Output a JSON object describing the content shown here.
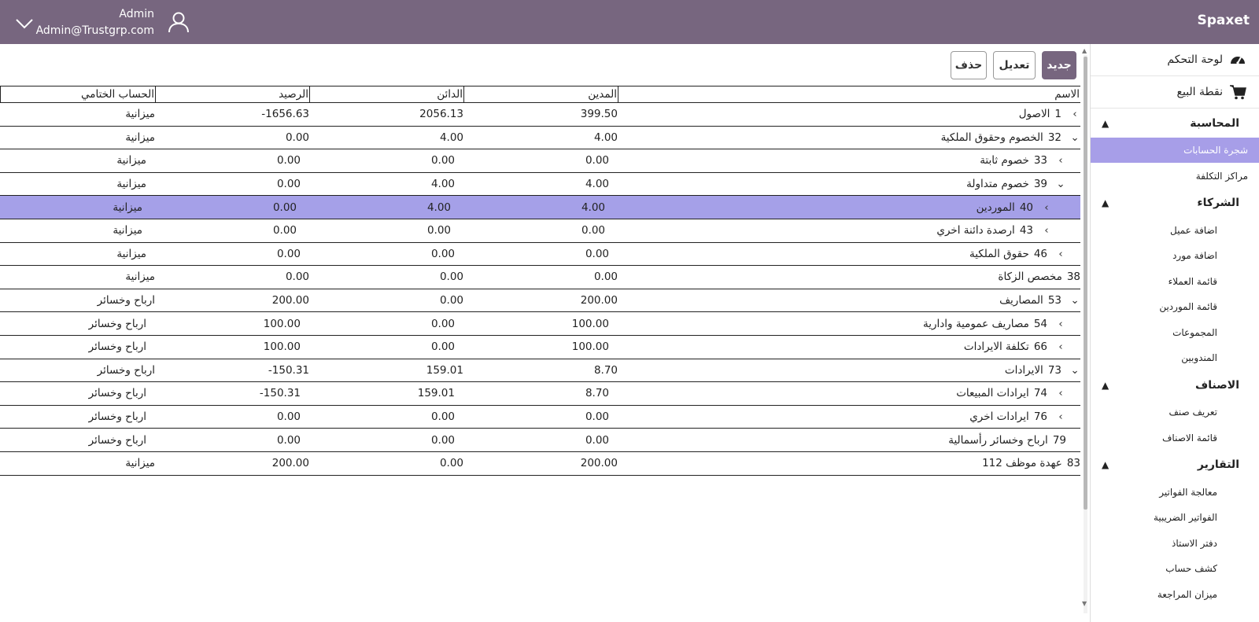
{
  "header": {
    "brand": "Spaxet",
    "user_name": "Admin",
    "user_email": "Admin@Trustgrp.com",
    "bg_color": "#77667f"
  },
  "toolbar": {
    "new_label": "جديد",
    "edit_label": "تعديل",
    "delete_label": "حذف"
  },
  "sidebar": {
    "dashboard": "لوحة التحكم",
    "pos": "نقطة البيع",
    "sections": [
      {
        "title": "المحاسبة",
        "items": [
          "شجرة الحسابات",
          "مراكز التكلفة"
        ]
      },
      {
        "title": "الشركاء",
        "items": [
          "اضافة عميل",
          "اضافة مورد",
          "قائمة العملاء",
          "قائمة الموردين",
          "المجموعات",
          "المندوبين"
        ]
      },
      {
        "title": "الاصناف",
        "items": [
          "تعريف صنف",
          "قائمة الاصناف"
        ]
      },
      {
        "title": "التقارير",
        "items": [
          "معالجة الفواتير",
          "الفواتير الضريبية",
          "دفتر الاستاذ",
          "كشف حساب",
          "ميزان المراجعة"
        ]
      }
    ],
    "active_item": "شجرة الحسابات",
    "active_color": "#a79ee8"
  },
  "table": {
    "columns": [
      "الاسم",
      "المدين",
      "الدائن",
      "الرصيد",
      "الحساب الختامي"
    ],
    "selected_color": "#a5a0e8",
    "rows": [
      {
        "code": "1",
        "name": "الاصول",
        "toggle": "›",
        "level": 0,
        "debit": "399.50",
        "credit": "2056.13",
        "balance": "-1656.63",
        "final": "ميزانية"
      },
      {
        "code": "32",
        "name": "الخصوم وحقوق الملكية",
        "toggle": "⌄",
        "level": 0,
        "debit": "4.00",
        "credit": "4.00",
        "balance": "0.00",
        "final": "ميزانية"
      },
      {
        "code": "33",
        "name": "خصوم ثابتة",
        "toggle": "›",
        "level": 1,
        "debit": "0.00",
        "credit": "0.00",
        "balance": "0.00",
        "final": "ميزانية"
      },
      {
        "code": "39",
        "name": "خصوم متداولة",
        "toggle": "⌄",
        "level": 1,
        "debit": "4.00",
        "credit": "4.00",
        "balance": "0.00",
        "final": "ميزانية"
      },
      {
        "code": "40",
        "name": "الموردين",
        "toggle": "›",
        "level": 2,
        "debit": "4.00",
        "credit": "4.00",
        "balance": "0.00",
        "final": "ميزانية",
        "selected": true
      },
      {
        "code": "43",
        "name": "ارصدة دائنة اخري",
        "toggle": "›",
        "level": 2,
        "debit": "0.00",
        "credit": "0.00",
        "balance": "0.00",
        "final": "ميزانية"
      },
      {
        "code": "46",
        "name": "حقوق الملكية",
        "toggle": "›",
        "level": 1,
        "debit": "0.00",
        "credit": "0.00",
        "balance": "0.00",
        "final": "ميزانية"
      },
      {
        "code": "38",
        "name": "مخصص الزكاة",
        "toggle": "",
        "level": 0,
        "debit": "0.00",
        "credit": "0.00",
        "balance": "0.00",
        "final": "ميزانية"
      },
      {
        "code": "53",
        "name": "المصاريف",
        "toggle": "⌄",
        "level": 0,
        "debit": "200.00",
        "credit": "0.00",
        "balance": "200.00",
        "final": "ارباح وخسائر"
      },
      {
        "code": "54",
        "name": "مصاريف عمومية وادارية",
        "toggle": "›",
        "level": 1,
        "debit": "100.00",
        "credit": "0.00",
        "balance": "100.00",
        "final": "ارباح وخسائر"
      },
      {
        "code": "66",
        "name": "تكلفة الايرادات",
        "toggle": "›",
        "level": 1,
        "debit": "100.00",
        "credit": "0.00",
        "balance": "100.00",
        "final": "ارباح وخسائر"
      },
      {
        "code": "73",
        "name": "الايرادات",
        "toggle": "⌄",
        "level": 0,
        "debit": "8.70",
        "credit": "159.01",
        "balance": "-150.31",
        "final": "ارباح وخسائر"
      },
      {
        "code": "74",
        "name": "ايرادات المبيعات",
        "toggle": "›",
        "level": 1,
        "debit": "8.70",
        "credit": "159.01",
        "balance": "-150.31",
        "final": "ارباح وخسائر"
      },
      {
        "code": "76",
        "name": "ايرادات اخري",
        "toggle": "›",
        "level": 1,
        "debit": "0.00",
        "credit": "0.00",
        "balance": "0.00",
        "final": "ارباح وخسائر"
      },
      {
        "code": "79",
        "name": "ارباح وخسائر رأسمالية",
        "toggle": "",
        "level": 1,
        "debit": "0.00",
        "credit": "0.00",
        "balance": "0.00",
        "final": "ارباح وخسائر"
      },
      {
        "code": "83",
        "name": "عهدة موظف 112",
        "toggle": "",
        "level": 0,
        "debit": "200.00",
        "credit": "0.00",
        "balance": "200.00",
        "final": "ميزانية"
      }
    ]
  }
}
